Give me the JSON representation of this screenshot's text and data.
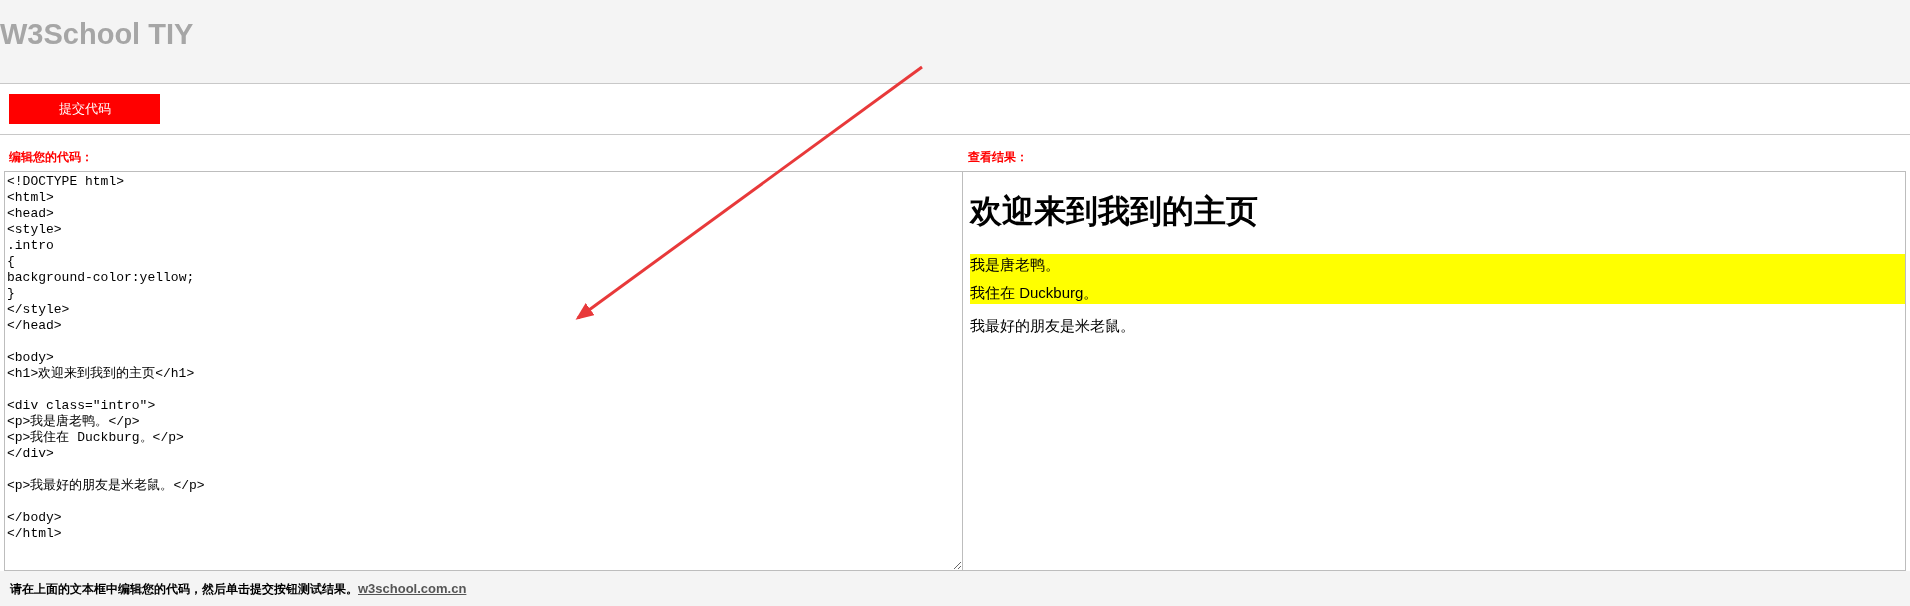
{
  "header": {
    "title": "W3School TIY"
  },
  "toolbar": {
    "submit_button": "提交代码"
  },
  "editor": {
    "label": "编辑您的代码：",
    "code": "<!DOCTYPE html>\n<html>\n<head>\n<style>\n.intro\n{\nbackground-color:yellow;\n}\n</style>\n</head>\n\n<body>\n<h1>欢迎来到我到的主页</h1>\n\n<div class=\"intro\">\n<p>我是唐老鸭。</p>\n<p>我住在 Duckburg。</p>\n</div>\n\n<p>我最好的朋友是米老鼠。</p>\n\n</body>\n</html>"
  },
  "result": {
    "label": "查看结果：",
    "heading": "欢迎来到我到的主页",
    "paragraphs": [
      {
        "text": "我是唐老鸭。",
        "highlighted": true
      },
      {
        "text": "我住在 Duckburg。",
        "highlighted": true
      },
      {
        "text": "我最好的朋友是米老鼠。",
        "highlighted": false
      }
    ]
  },
  "footer": {
    "note": "请在上面的文本框中编辑您的代码，然后单击提交按钮测试结果。",
    "link": "w3school.com.cn"
  }
}
